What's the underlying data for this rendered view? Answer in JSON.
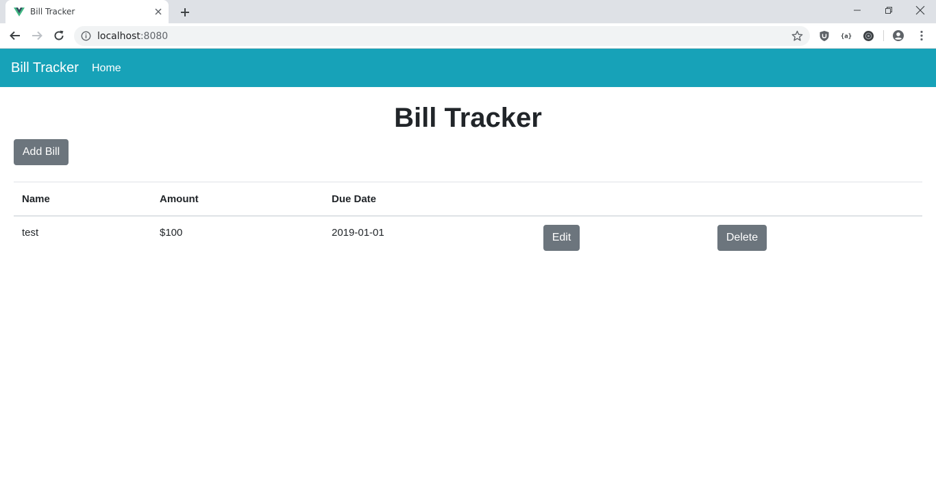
{
  "browser": {
    "tab_title": "Bill Tracker",
    "url_host": "localhost",
    "url_port": ":8080"
  },
  "icons": {
    "favicon": "vue-logo-icon",
    "tab_close": "close-icon",
    "new_tab": "plus-icon",
    "back": "arrow-left-icon",
    "forward": "arrow-right-icon",
    "reload": "reload-icon",
    "site_info": "info-icon",
    "bookmark": "star-icon",
    "extensions": [
      "shield-extension-icon",
      "json-extension-icon",
      "dark-circle-extension-icon"
    ],
    "profile": "profile-icon",
    "menu": "more-vert-icon"
  },
  "colors": {
    "navbar": "#17a2b8",
    "button": "#6c757d",
    "text": "#212529"
  },
  "navbar": {
    "brand": "Bill Tracker",
    "links": [
      "Home"
    ]
  },
  "main": {
    "title": "Bill Tracker",
    "add_button": "Add Bill",
    "table": {
      "headers": [
        "Name",
        "Amount",
        "Due Date"
      ],
      "rows": [
        {
          "name": "test",
          "amount": "$100",
          "due_date": "2019-01-01",
          "edit_label": "Edit",
          "delete_label": "Delete"
        }
      ]
    }
  }
}
